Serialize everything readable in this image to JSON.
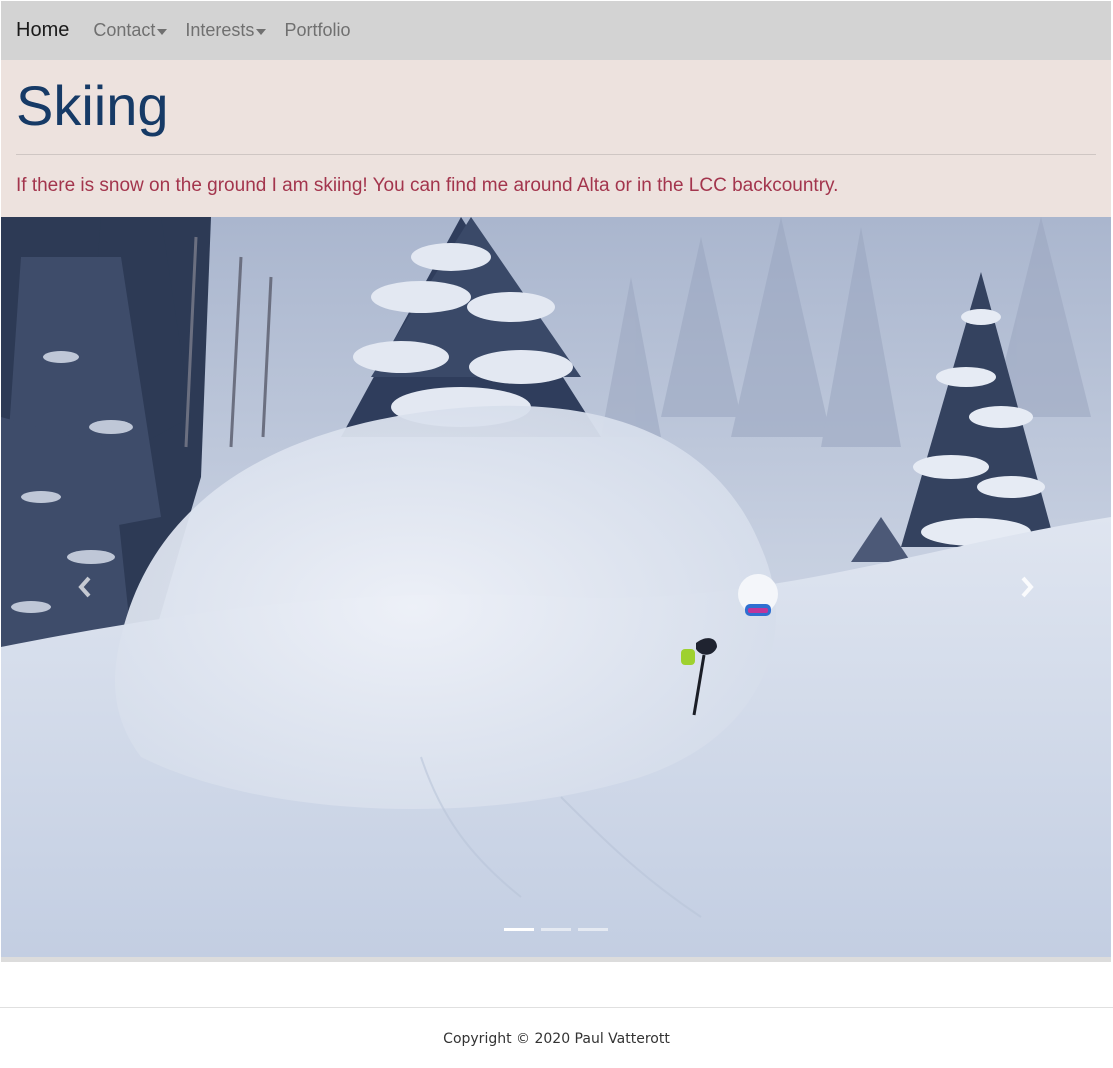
{
  "navbar": {
    "brand": "Home",
    "items": [
      {
        "label": "Contact",
        "dropdown": true
      },
      {
        "label": "Interests",
        "dropdown": true
      },
      {
        "label": "Portfolio",
        "dropdown": false
      }
    ]
  },
  "jumbotron": {
    "title": "Skiing",
    "lead": "If there is snow on the ground I am skiing! You can find me around Alta or in the LCC backcountry."
  },
  "carousel": {
    "slide_count": 3,
    "active_slide": 1,
    "prev_icon": "chevron-left-icon",
    "next_icon": "chevron-right-icon"
  },
  "footer": {
    "copyright": "Copyright © 2020 Paul Vatterott"
  },
  "colors": {
    "navbar_bg": "#d3d3d3",
    "jumbotron_bg": "#ede2de",
    "title": "#163a66",
    "lead": "#a3354d"
  }
}
